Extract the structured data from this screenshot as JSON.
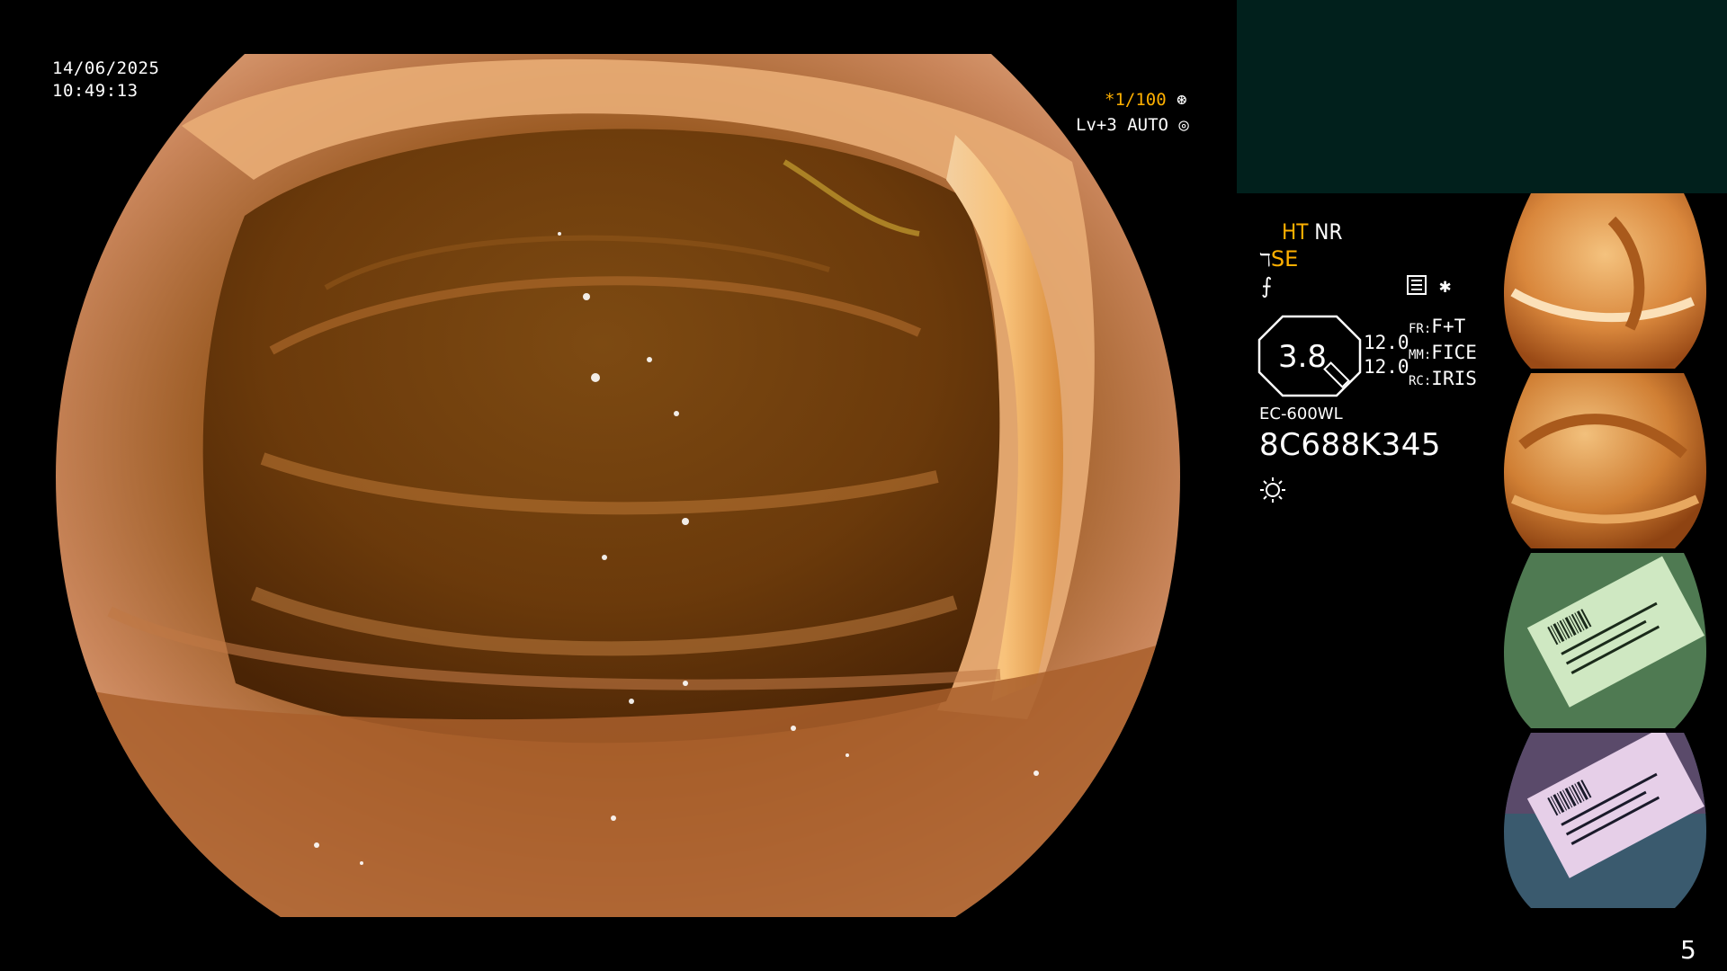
{
  "timestamp": {
    "date": "14/06/2025",
    "time": "10:49:13"
  },
  "overlay": {
    "shutter": "*1/100",
    "level": "Lv+3 AUTO"
  },
  "info": {
    "ht": "HT",
    "nr": "NR",
    "se": "SE",
    "zoom": "3.8",
    "zoom_val_1": "12.0",
    "zoom_val_2": "12.0",
    "fr_key": "FR:",
    "fr_val": "F+T",
    "mm_key": "MM:",
    "mm_val": "FICE",
    "rc_key": "RC:",
    "rc_val": "IRIS",
    "model": "EC-600WL",
    "serial": "8C688K345"
  },
  "page_number": "5",
  "colors": {
    "amber": "#ffb000",
    "teal_panel": "#01201c"
  },
  "icons": [
    "shutter-icon",
    "auto-icon",
    "mode-icon",
    "star-icon",
    "brightness-icon"
  ]
}
